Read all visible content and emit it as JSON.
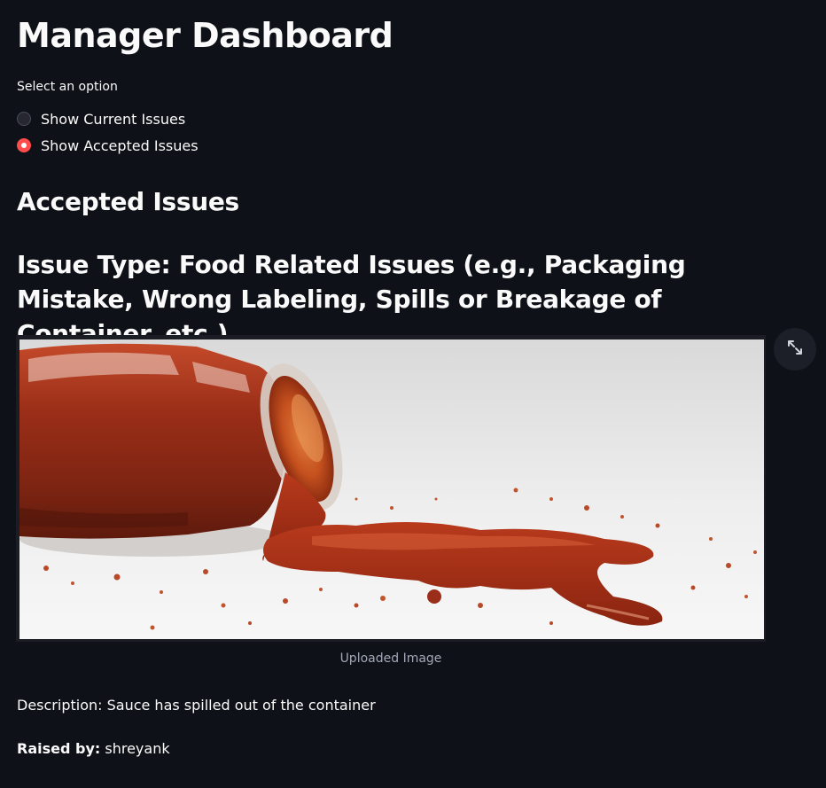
{
  "page": {
    "title": "Manager Dashboard"
  },
  "radio": {
    "label": "Select an option",
    "options": [
      {
        "label": "Show Current Issues",
        "selected": false
      },
      {
        "label": "Show Accepted Issues",
        "selected": true
      }
    ],
    "accent_color": "#ff4b4b"
  },
  "section": {
    "subheader": "Accepted Issues",
    "issue_type": "Issue Type: Food Related Issues (e.g., Packaging Mistake, Wrong Labeling, Spills or Breakage of Container, etc.)"
  },
  "image": {
    "caption": "Uploaded Image",
    "fullscreen_icon": "expand-icon"
  },
  "details": {
    "description": "Description: Sauce has spilled out of the container",
    "raised_by_label": "Raised by:",
    "raised_by_value": "shreyank"
  }
}
